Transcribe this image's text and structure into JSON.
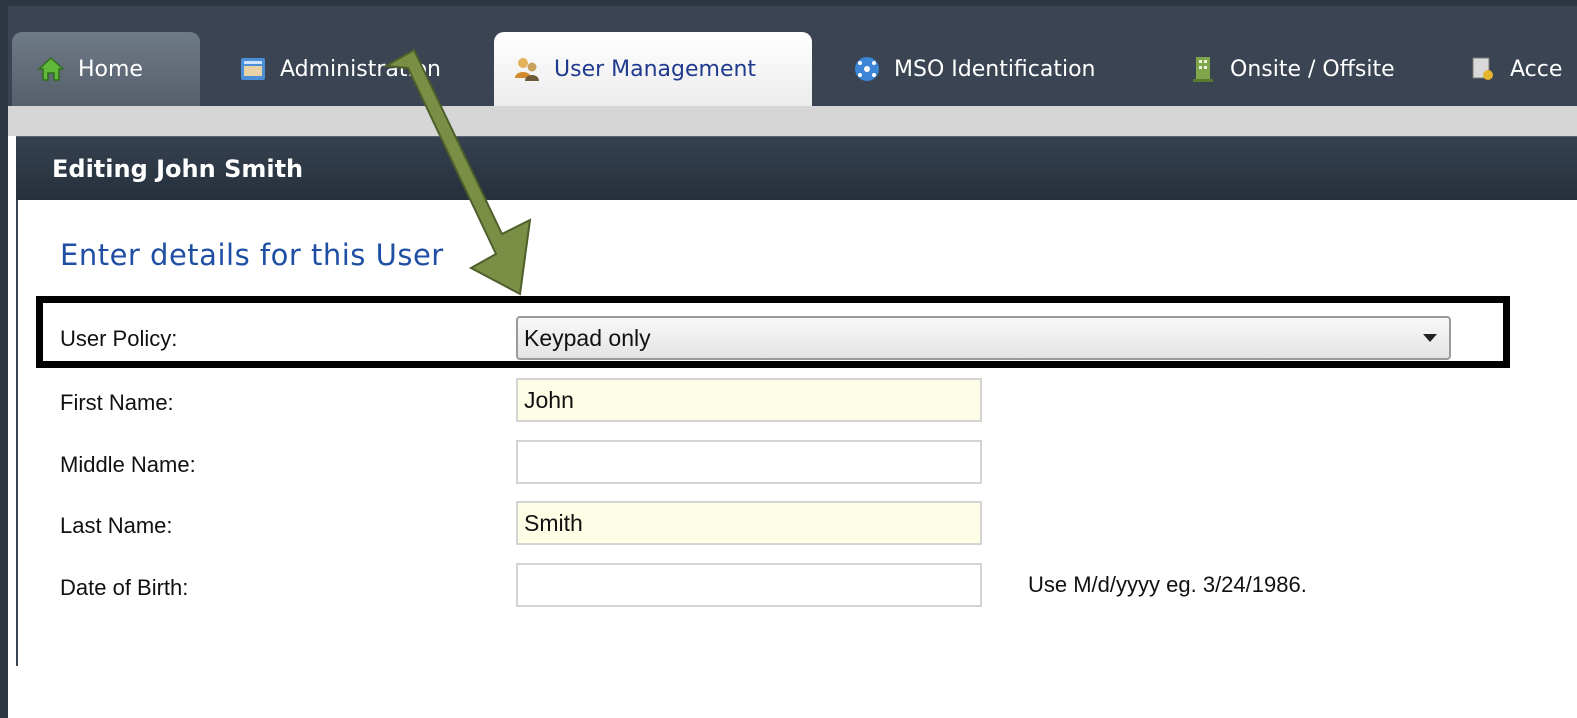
{
  "tabs": [
    {
      "label": "Home",
      "icon": "home-icon"
    },
    {
      "label": "Administration",
      "icon": "administration-icon"
    },
    {
      "label": "User Management",
      "icon": "users-icon"
    },
    {
      "label": "MSO Identification",
      "icon": "network-icon"
    },
    {
      "label": "Onsite / Offsite",
      "icon": "building-icon"
    },
    {
      "label": "Acce",
      "icon": "access-icon"
    }
  ],
  "active_tab": "User Management",
  "panel": {
    "header": "Editing John Smith",
    "section_title": "Enter details for this User"
  },
  "form": {
    "user_policy": {
      "label": "User Policy:",
      "value": "Keypad only"
    },
    "first_name": {
      "label": "First Name:",
      "value": "John"
    },
    "middle_name": {
      "label": "Middle Name:",
      "value": ""
    },
    "last_name": {
      "label": "Last Name:",
      "value": "Smith"
    },
    "date_of_birth": {
      "label": "Date of Birth:",
      "value": "",
      "hint": "Use M/d/yyyy eg. 3/24/1986."
    }
  },
  "colors": {
    "tab_bar": "#3a4452",
    "active_tab_text": "#1f3a8f",
    "section_title": "#1f4fa5",
    "required_field_bg": "#fefde6",
    "annotation_arrow": "#7a8f45"
  }
}
